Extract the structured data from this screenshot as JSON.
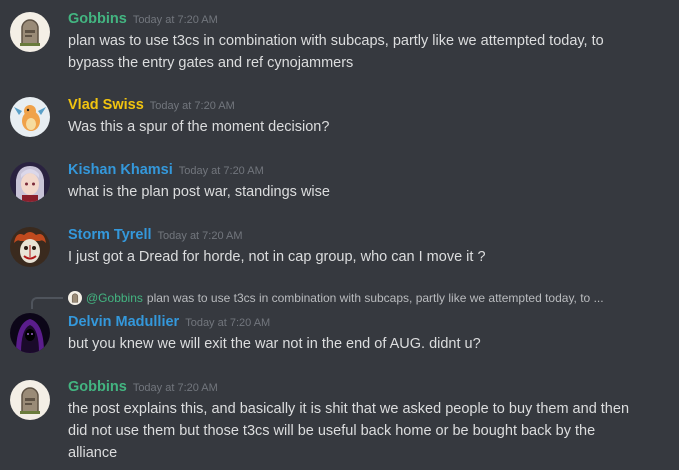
{
  "colors": {
    "background": "#36393f",
    "name_green": "#43b581",
    "name_yellow": "#f1c40f",
    "name_blue": "#3498db",
    "timestamp": "#72767d",
    "text": "#dcddde"
  },
  "messages": [
    {
      "author": "Gobbins",
      "author_color": "#43b581",
      "timestamp": "Today at 7:20 AM",
      "avatar_icon": "tombstone-avatar-icon",
      "lines": [
        "plan was to use t3cs in combination with subcaps, partly like we attempted today, to",
        "bypass the entry gates and ref cynojammers"
      ]
    },
    {
      "author": "Vlad Swiss",
      "author_color": "#f1c40f",
      "timestamp": "Today at 7:20 AM",
      "avatar_icon": "dragon-avatar-icon",
      "lines": [
        "Was this a spur of the moment decision?"
      ]
    },
    {
      "author": "Kishan Khamsi",
      "author_color": "#3498db",
      "timestamp": "Today at 7:20 AM",
      "avatar_icon": "anime-avatar-icon",
      "lines": [
        "what is the plan post war, standings wise"
      ]
    },
    {
      "author": "Storm Tyrell",
      "author_color": "#3498db",
      "timestamp": "Today at 7:20 AM",
      "avatar_icon": "clown-avatar-icon",
      "lines": [
        "I just got a Dread for horde, not in cap group, who can I move it ?"
      ]
    },
    {
      "reply_to": {
        "mention": "@Gobbins",
        "excerpt": "plan was to use t3cs in combination with subcaps, partly like we attempted today, to ..."
      },
      "author": "Delvin Madullier",
      "author_color": "#3498db",
      "timestamp": "Today at 7:20 AM",
      "avatar_icon": "hooded-figure-avatar-icon",
      "lines": [
        "but you knew we will exit the war not in the end of AUG. didnt u?"
      ]
    },
    {
      "author": "Gobbins",
      "author_color": "#43b581",
      "timestamp": "Today at 7:20 AM",
      "avatar_icon": "tombstone-avatar-icon",
      "lines": [
        "the post explains this, and basically it is shit that we asked people to buy them and then",
        "did not use them but those t3cs will be useful back home or be bought back by the",
        "alliance"
      ]
    }
  ]
}
